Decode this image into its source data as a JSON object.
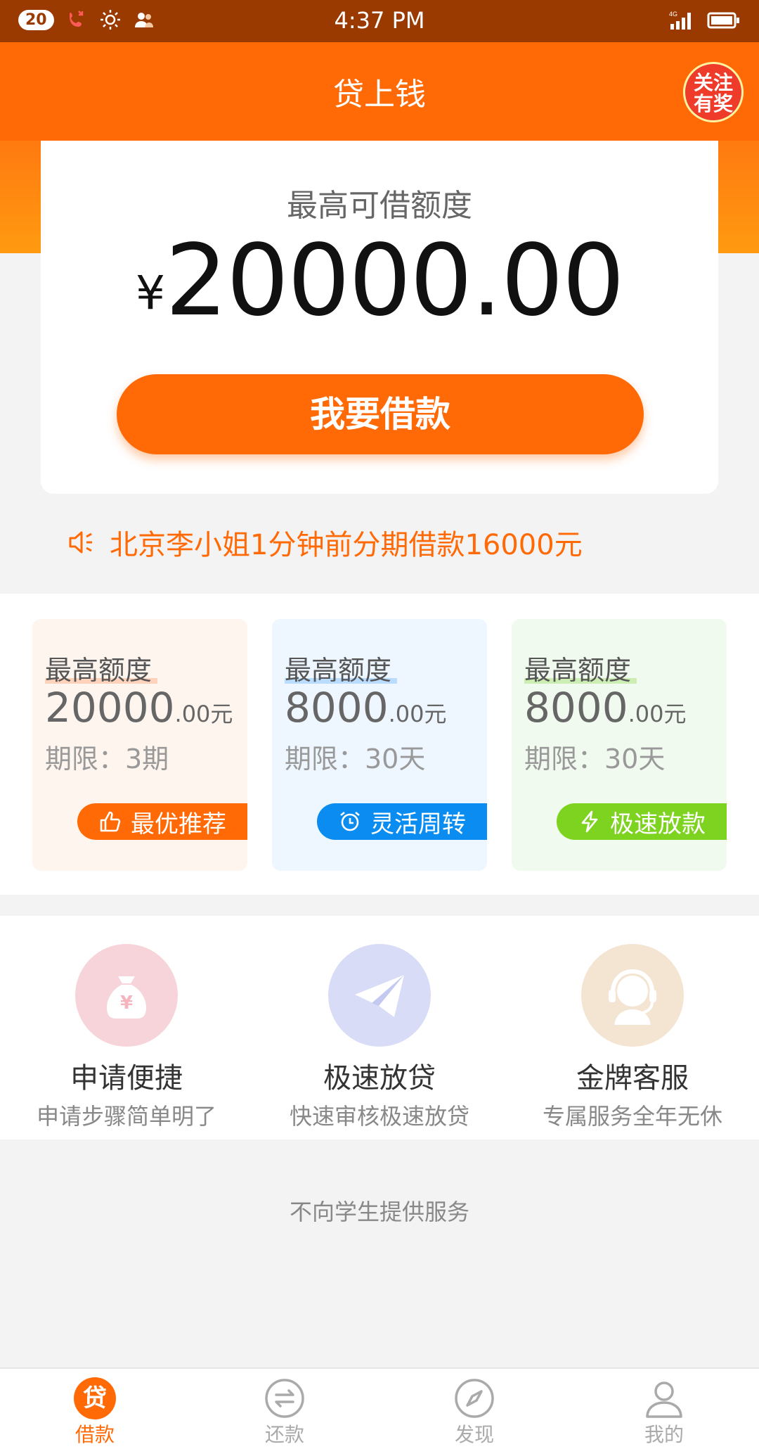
{
  "status_bar": {
    "notification_count": "20",
    "time": "4:37 PM",
    "network": "4G"
  },
  "header": {
    "title": "贷上钱",
    "promo_badge": "关注\n有奖"
  },
  "hero": {
    "label": "最高可借额度",
    "currency": "¥",
    "amount": "20000.00",
    "button": "我要借款"
  },
  "ticker": {
    "text": "北京李小姐1分钟前分期借款16000元"
  },
  "products": [
    {
      "label": "最高额度",
      "amount_int": "20000",
      "amount_dec": ".00元",
      "term": "期限：3期",
      "tag": "最优推荐",
      "tag_icon": "thumbs-up-icon",
      "bg": "#fff5ef",
      "accent": "#ff6a06",
      "underline": "#ffd3bb"
    },
    {
      "label": "最高额度",
      "amount_int": "8000",
      "amount_dec": ".00元",
      "term": "期限：30天",
      "tag": "灵活周转",
      "tag_icon": "alarm-clock-icon",
      "bg": "#eef6ff",
      "accent": "#0a8cf0",
      "underline": "#b9dcff"
    },
    {
      "label": "最高额度",
      "amount_int": "8000",
      "amount_dec": ".00元",
      "term": "期限：30天",
      "tag": "极速放款",
      "tag_icon": "lightning-icon",
      "bg": "#f1faef",
      "accent": "#7ed321",
      "underline": "#cdeeb2"
    }
  ],
  "features": [
    {
      "title": "申请便捷",
      "subtitle": "申请步骤简单明了",
      "icon": "money-bag-icon",
      "color": "#f7d4da"
    },
    {
      "title": "极速放贷",
      "subtitle": "快速审核极速放贷",
      "icon": "paper-plane-icon",
      "color": "#d8dcf6"
    },
    {
      "title": "金牌客服",
      "subtitle": "专属服务全年无休",
      "icon": "headset-agent-icon",
      "color": "#f4e4d2"
    }
  ],
  "notice": "不向学生提供服务",
  "tabs": [
    {
      "label": "借款",
      "icon": "loan-icon",
      "glyph": "贷",
      "active": true
    },
    {
      "label": "还款",
      "icon": "repay-icon",
      "active": false
    },
    {
      "label": "发现",
      "icon": "compass-icon",
      "active": false
    },
    {
      "label": "我的",
      "icon": "profile-icon",
      "active": false
    }
  ],
  "colors": {
    "brand": "#ff6a06",
    "status_bar": "#9a3a00"
  }
}
